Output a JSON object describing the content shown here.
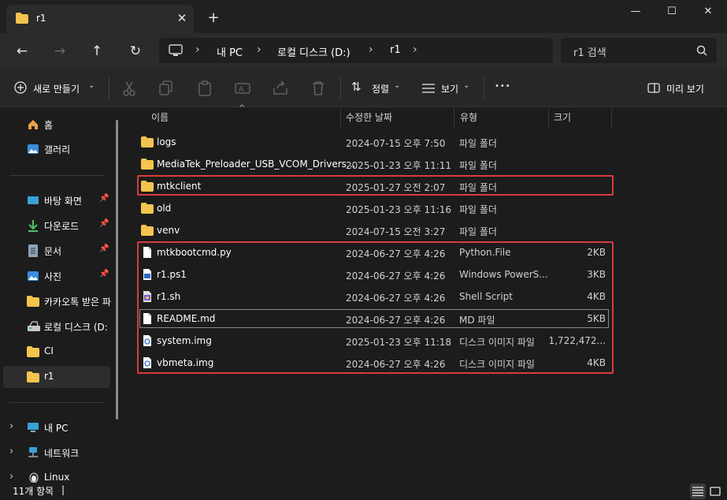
{
  "tab": {
    "title": "r1",
    "close_glyph": "✕",
    "new_glyph": "+"
  },
  "window": {
    "minimize": "—",
    "maximize": "☐",
    "close": "✕"
  },
  "address": {
    "crumbs": [
      "내 PC",
      "로컬 디스크 (D:)",
      "r1"
    ],
    "search_placeholder": "r1 검색"
  },
  "toolbar": {
    "new_label": "새로 만들기",
    "sort_label": "정렬",
    "view_label": "보기",
    "more_glyph": "•••",
    "preview_label": "미리 보기"
  },
  "nav": {
    "home": "홈",
    "gallery": "갤러리",
    "desktop": "바탕 화면",
    "downloads": "다운로드",
    "documents": "문서",
    "pictures": "사진",
    "kakao": "카카오톡 받은 파",
    "local_disk": "로컬 디스크 (D:",
    "ci": "CI",
    "r1": "r1",
    "this_pc": "내 PC",
    "network": "네트워크",
    "linux": "Linux"
  },
  "columns": {
    "name": "이름",
    "date": "수정한 날짜",
    "type": "유형",
    "size": "크기"
  },
  "files": [
    {
      "name": "logs",
      "date": "2024-07-15 오후 7:50",
      "type": "파일 폴더",
      "size": "",
      "icon": "folder-icon"
    },
    {
      "name": "MediaTek_Preloader_USB_VCOM_Drivers...",
      "date": "2025-01-23 오후 11:11",
      "type": "파일 폴더",
      "size": "",
      "icon": "folder-icon"
    },
    {
      "name": "mtkclient",
      "date": "2025-01-27 오전 2:07",
      "type": "파일 폴더",
      "size": "",
      "icon": "folder-icon"
    },
    {
      "name": "old",
      "date": "2025-01-23 오후 11:16",
      "type": "파일 폴더",
      "size": "",
      "icon": "folder-icon"
    },
    {
      "name": "venv",
      "date": "2024-07-15 오전 3:27",
      "type": "파일 폴더",
      "size": "",
      "icon": "folder-icon"
    },
    {
      "name": "mtkbootcmd.py",
      "date": "2024-06-27 오후 4:26",
      "type": "Python.File",
      "size": "2KB",
      "icon": "document-icon"
    },
    {
      "name": "r1.ps1",
      "date": "2024-06-27 오후 4:26",
      "type": "Windows PowerS...",
      "size": "3KB",
      "icon": "powershell-script-icon"
    },
    {
      "name": "r1.sh",
      "date": "2024-06-27 오후 4:26",
      "type": "Shell Script",
      "size": "4KB",
      "icon": "shell-script-icon"
    },
    {
      "name": "README.md",
      "date": "2024-06-27 오후 4:26",
      "type": "MD 파일",
      "size": "5KB",
      "icon": "document-icon"
    },
    {
      "name": "system.img",
      "date": "2025-01-23 오후 11:18",
      "type": "디스크 이미지 파일",
      "size": "1,722,472...",
      "icon": "disk-image-icon"
    },
    {
      "name": "vbmeta.img",
      "date": "2024-06-27 오후 4:26",
      "type": "디스크 이미지 파일",
      "size": "4KB",
      "icon": "disk-image-icon"
    }
  ],
  "status": {
    "count": "11개 항목",
    "cursor": "|"
  },
  "colors": {
    "highlight": "#d83b3b",
    "folder": "#f5c44f",
    "accent": "#4cc2ff"
  }
}
